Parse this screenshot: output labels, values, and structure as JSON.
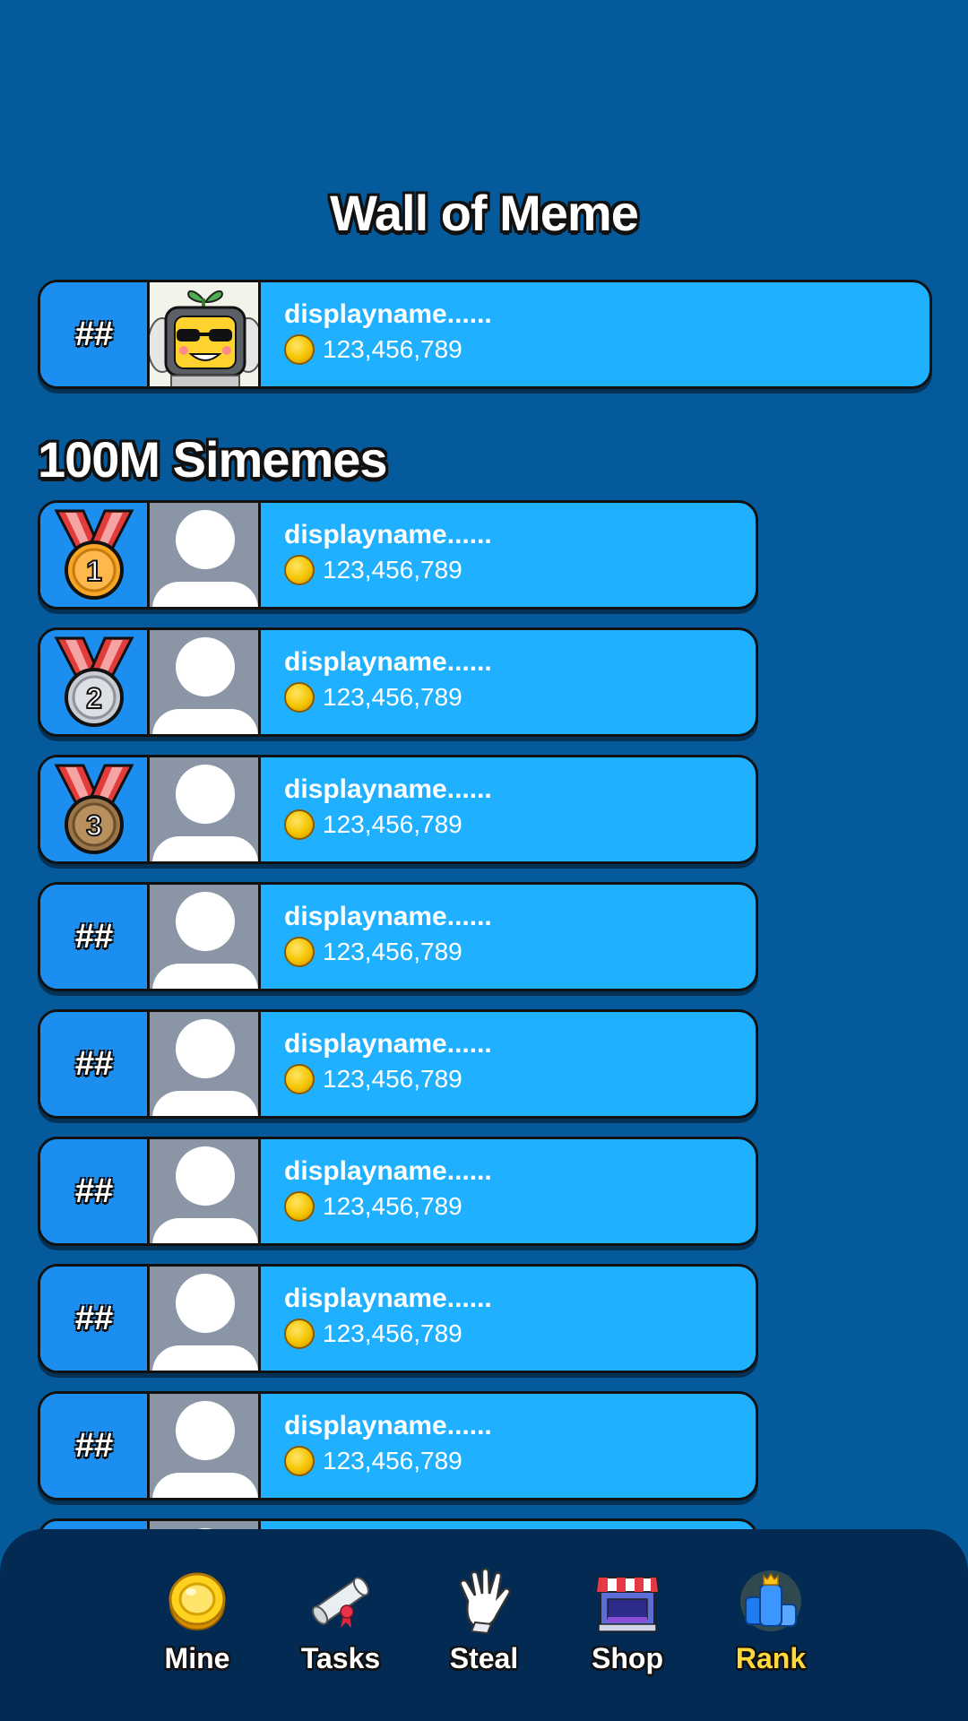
{
  "header": {
    "title": "Wall of Meme"
  },
  "featured": {
    "rank": "##",
    "name": "displayname......",
    "score": "123,456,789"
  },
  "section": {
    "title": "100M Simemes"
  },
  "rows": [
    {
      "rank": "1",
      "medal": "gold-medal-icon",
      "name": "displayname......",
      "score": "123,456,789"
    },
    {
      "rank": "2",
      "medal": "silver-medal-icon",
      "name": "displayname......",
      "score": "123,456,789"
    },
    {
      "rank": "3",
      "medal": "bronze-medal-icon",
      "name": "displayname......",
      "score": "123,456,789"
    },
    {
      "rank": "##",
      "name": "displayname......",
      "score": "123,456,789"
    },
    {
      "rank": "##",
      "name": "displayname......",
      "score": "123,456,789"
    },
    {
      "rank": "##",
      "name": "displayname......",
      "score": "123,456,789"
    },
    {
      "rank": "##",
      "name": "displayname......",
      "score": "123,456,789"
    },
    {
      "rank": "##",
      "name": "displayname......",
      "score": "123,456,789"
    }
  ],
  "nav": {
    "items": [
      {
        "label": "Mine",
        "icon": "coin-icon"
      },
      {
        "label": "Tasks",
        "icon": "scroll-icon"
      },
      {
        "label": "Steal",
        "icon": "hand-icon"
      },
      {
        "label": "Shop",
        "icon": "shop-icon"
      },
      {
        "label": "Rank",
        "icon": "trophy-icon",
        "active": true
      }
    ]
  },
  "colors": {
    "background": "#055a9c",
    "row": "#1fb0ff",
    "rank_cell": "#1c8ef0",
    "nav_bar": "#022a52",
    "active_label": "#ffd93b",
    "gold": "#f6a623",
    "silver": "#c9ccd2",
    "bronze": "#9c7548"
  }
}
